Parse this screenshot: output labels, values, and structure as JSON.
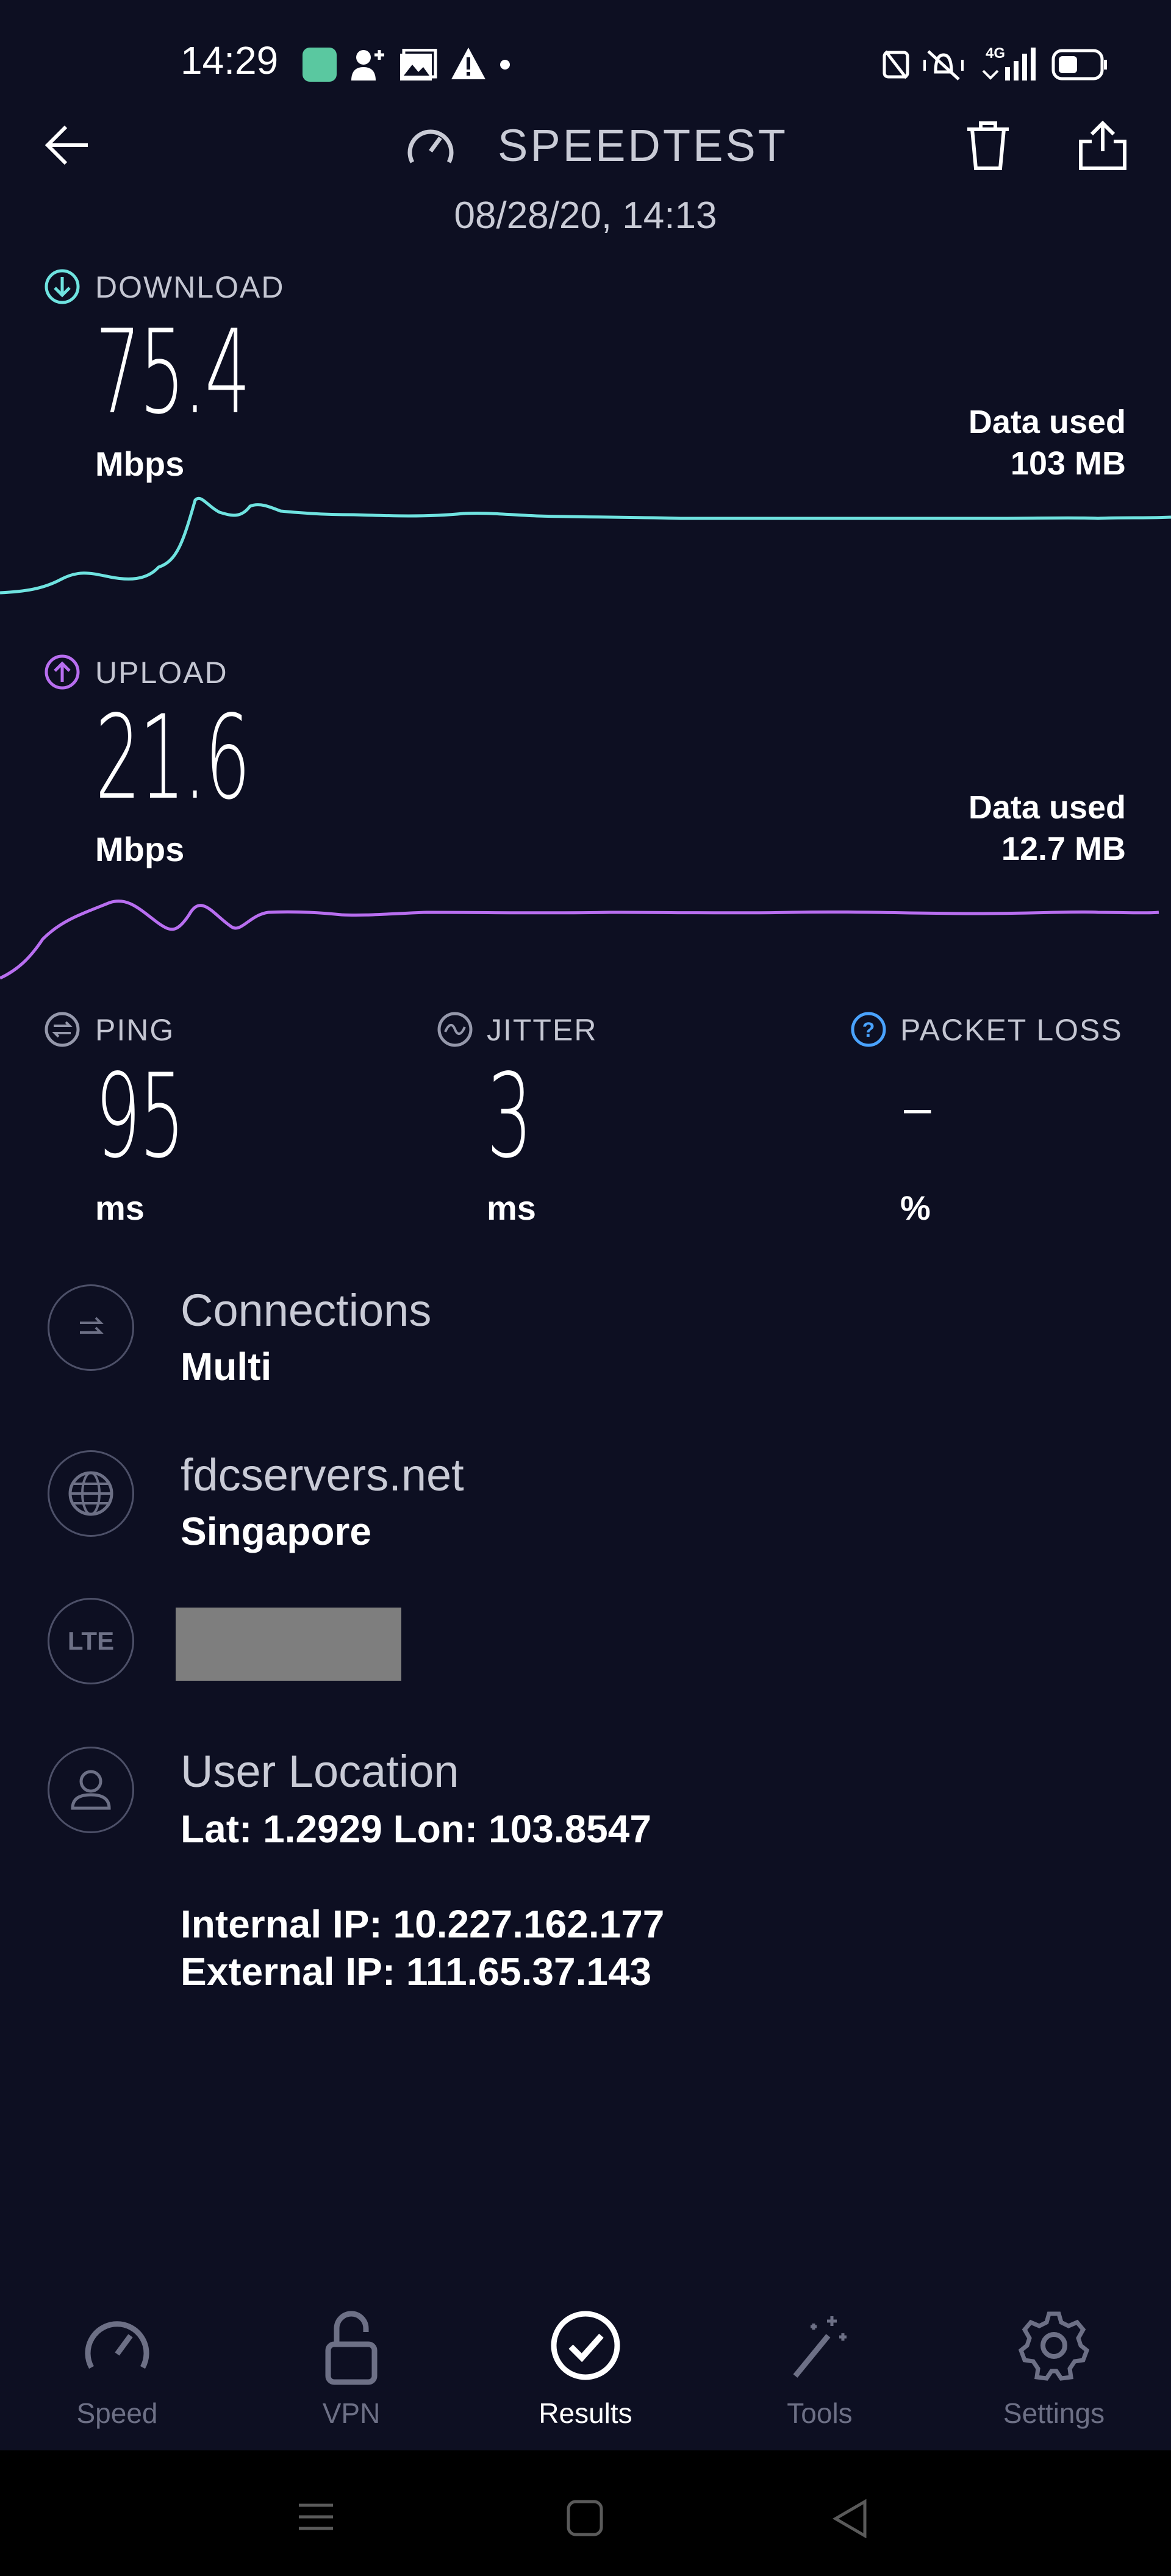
{
  "status_bar": {
    "time": "14:29",
    "network_label": "4G"
  },
  "header": {
    "title": "SPEEDTEST",
    "date": "08/28/20, 14:13"
  },
  "download": {
    "label": "DOWNLOAD",
    "value": "75.4",
    "unit": "Mbps",
    "data_used_label": "Data used",
    "data_used_value": "103 MB",
    "color": "#6fe3e0"
  },
  "upload": {
    "label": "UPLOAD",
    "value": "21.6",
    "unit": "Mbps",
    "data_used_label": "Data used",
    "data_used_value": "12.7 MB",
    "color": "#b86ef0"
  },
  "metrics": {
    "ping": {
      "label": "PING",
      "value": "95",
      "unit": "ms"
    },
    "jitter": {
      "label": "JITTER",
      "value": "3",
      "unit": "ms"
    },
    "packet_loss": {
      "label": "PACKET LOSS",
      "value": "–",
      "unit": "%"
    }
  },
  "connections": {
    "title": "Connections",
    "value": "Multi"
  },
  "server": {
    "host": "fdcservers.net",
    "location": "Singapore"
  },
  "network": {
    "icon_text": "LTE"
  },
  "user_location": {
    "title": "User Location",
    "coords": "Lat: 1.2929 Lon: 103.8547",
    "internal_ip": "Internal IP: 10.227.162.177",
    "external_ip": "External IP: 111.65.37.143"
  },
  "bottom_nav": [
    {
      "label": "Speed",
      "icon": "speedometer-icon",
      "active": false
    },
    {
      "label": "VPN",
      "icon": "unlock-icon",
      "active": false
    },
    {
      "label": "Results",
      "icon": "check-circle-icon",
      "active": true
    },
    {
      "label": "Tools",
      "icon": "magic-wand-icon",
      "active": false
    },
    {
      "label": "Settings",
      "icon": "gear-icon",
      "active": false
    }
  ]
}
